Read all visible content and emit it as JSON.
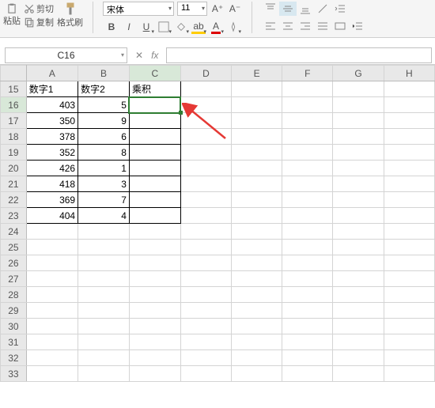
{
  "ribbon": {
    "paste_label": "粘贴",
    "cut_label": "剪切",
    "copy_label": "复制",
    "format_painter_label": "格式刷",
    "font_name": "宋体",
    "font_size": "11",
    "bold": "B",
    "italic": "I",
    "underline": "U"
  },
  "namebox": {
    "value": "C16"
  },
  "formula": {
    "fx": "fx",
    "value": ""
  },
  "colHeaders": [
    "A",
    "B",
    "C",
    "D",
    "E",
    "F",
    "G",
    "H"
  ],
  "rows": [
    {
      "n": "15",
      "a": "数字1",
      "b": "数字2",
      "c": "乘积",
      "textrow": true
    },
    {
      "n": "16",
      "a": "403",
      "b": "5",
      "c": "",
      "sel": true
    },
    {
      "n": "17",
      "a": "350",
      "b": "9",
      "c": ""
    },
    {
      "n": "18",
      "a": "378",
      "b": "6",
      "c": ""
    },
    {
      "n": "19",
      "a": "352",
      "b": "8",
      "c": ""
    },
    {
      "n": "20",
      "a": "426",
      "b": "1",
      "c": ""
    },
    {
      "n": "21",
      "a": "418",
      "b": "3",
      "c": ""
    },
    {
      "n": "22",
      "a": "369",
      "b": "7",
      "c": ""
    },
    {
      "n": "23",
      "a": "404",
      "b": "4",
      "c": ""
    },
    {
      "n": "24"
    },
    {
      "n": "25"
    },
    {
      "n": "26"
    },
    {
      "n": "27"
    },
    {
      "n": "28"
    },
    {
      "n": "29"
    },
    {
      "n": "30"
    },
    {
      "n": "31"
    },
    {
      "n": "32"
    },
    {
      "n": "33"
    }
  ],
  "chart_data": {
    "type": "table",
    "columns": [
      "数字1",
      "数字2",
      "乘积"
    ],
    "rows": [
      [
        403,
        5,
        null
      ],
      [
        350,
        9,
        null
      ],
      [
        378,
        6,
        null
      ],
      [
        352,
        8,
        null
      ],
      [
        426,
        1,
        null
      ],
      [
        418,
        3,
        null
      ],
      [
        369,
        7,
        null
      ],
      [
        404,
        4,
        null
      ]
    ]
  }
}
